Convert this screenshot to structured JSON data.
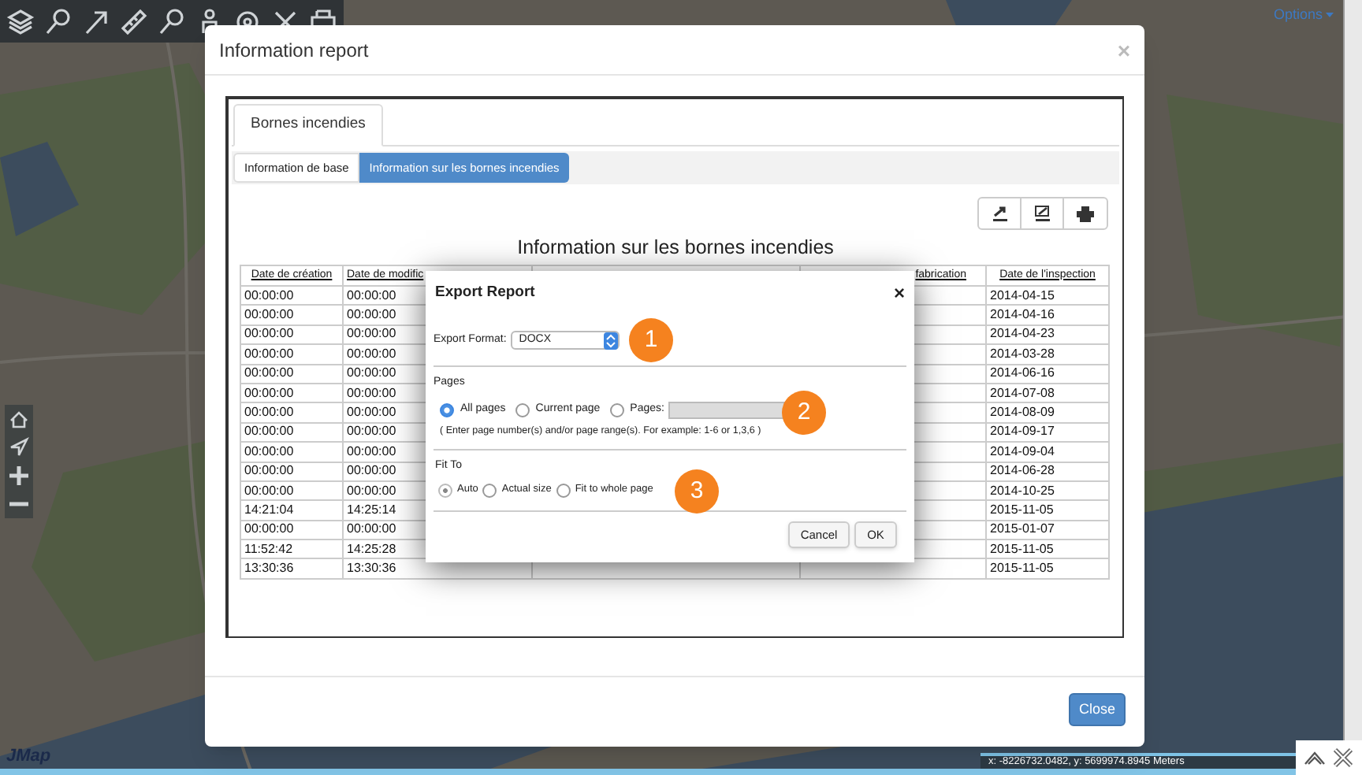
{
  "map": {
    "options_link": "Options",
    "coordinates": "x: -8226732.0482, y: 5699974.8945 Meters",
    "logo": "JMap"
  },
  "report_window": {
    "title": "Information report",
    "close": "×",
    "tabs": [
      {
        "label": "Bornes incendies",
        "selected": true
      }
    ],
    "subtabs": [
      {
        "label": "Information de base",
        "selected": false
      },
      {
        "label": "Information sur les bornes incendies",
        "selected": true
      }
    ],
    "report_title": "Information sur les bornes incendies",
    "table": {
      "columns": [
        "Date de création",
        "Date de modific",
        "fabrication",
        "Date de l'inspection"
      ],
      "rows": [
        {
          "creation": "00:00:00",
          "modification": "00:00:00",
          "inspection": "2014-04-15"
        },
        {
          "creation": "00:00:00",
          "modification": "00:00:00",
          "inspection": "2014-04-16"
        },
        {
          "creation": "00:00:00",
          "modification": "00:00:00",
          "inspection": "2014-04-23"
        },
        {
          "creation": "00:00:00",
          "modification": "00:00:00",
          "inspection": "2014-03-28"
        },
        {
          "creation": "00:00:00",
          "modification": "00:00:00",
          "inspection": "2014-06-16"
        },
        {
          "creation": "00:00:00",
          "modification": "00:00:00",
          "inspection": "2014-07-08"
        },
        {
          "creation": "00:00:00",
          "modification": "00:00:00",
          "inspection": "2014-08-09"
        },
        {
          "creation": "00:00:00",
          "modification": "00:00:00",
          "inspection": "2014-09-17"
        },
        {
          "creation": "00:00:00",
          "modification": "00:00:00",
          "inspection": "2014-09-04"
        },
        {
          "creation": "00:00:00",
          "modification": "00:00:00",
          "inspection": "2014-06-28"
        },
        {
          "creation": "00:00:00",
          "modification": "00:00:00",
          "inspection": "2014-10-25"
        },
        {
          "creation": "14:21:04",
          "modification": "14:25:14",
          "inspection": "2015-11-05"
        },
        {
          "creation": "00:00:00",
          "modification": "00:00:00",
          "inspection": "2015-01-07"
        },
        {
          "creation": "11:52:42",
          "modification": "14:25:28",
          "inspection": "2015-11-05"
        },
        {
          "creation": "13:30:36",
          "modification": "13:30:36",
          "inspection": "2015-11-05"
        }
      ]
    },
    "close_button": "Close"
  },
  "export_dialog": {
    "title": "Export Report",
    "close": "×",
    "format_label": "Export Format:",
    "format_value": "DOCX",
    "pages_label": "Pages",
    "page_options": [
      {
        "label": "All pages",
        "selected": true
      },
      {
        "label": "Current page",
        "selected": false
      },
      {
        "label": "Pages:",
        "selected": false
      }
    ],
    "pages_hint": "( Enter page number(s) and/or page range(s). For example: 1-6 or 1,3,6 )",
    "fit_label": "Fit To",
    "fit_options": [
      {
        "label": "Auto",
        "selected": true
      },
      {
        "label": "Actual size",
        "selected": false
      },
      {
        "label": "Fit to whole page",
        "selected": false
      }
    ],
    "callouts": [
      "1",
      "2",
      "3"
    ],
    "buttons": [
      "Cancel",
      "OK"
    ]
  }
}
